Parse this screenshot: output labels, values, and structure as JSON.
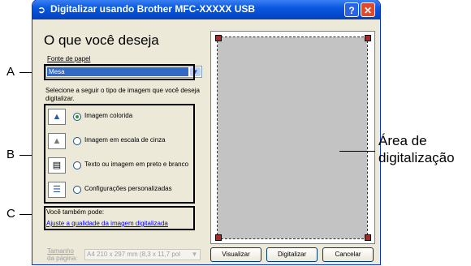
{
  "window": {
    "title": "Digitalizar usando Brother MFC-XXXXX USB",
    "help_label": "?",
    "close_label": "✕"
  },
  "left_panel": {
    "heading": "O que você deseja",
    "paper_source_label": "Fonte de papel",
    "paper_source_value": "Mesa",
    "instruction": "Selecione a seguir o tipo de imagem que você deseja digitalizar.",
    "options": [
      {
        "label": "Imagem colorida",
        "selected": true,
        "icon": "color-image-icon"
      },
      {
        "label": "Imagem em escala de cinza",
        "selected": false,
        "icon": "grayscale-image-icon"
      },
      {
        "label": "Texto ou imagem em preto e branco",
        "selected": false,
        "icon": "black-white-text-icon"
      },
      {
        "label": "Configurações personalizadas",
        "selected": false,
        "icon": "custom-settings-icon"
      }
    ],
    "also_label": "Você também pode:",
    "adjust_link": "Ajuste a qualidade da imagem digitalizada",
    "page_size_label_1": "Tamanho",
    "page_size_label_2": "da página:",
    "page_size_value": "A4 210 x 297 mm (8,3 x 11,7 pol"
  },
  "buttons": {
    "preview": "Visualizar",
    "scan": "Digitalizar",
    "cancel": "Cancelar"
  },
  "callouts": {
    "a": "A",
    "b": "B",
    "c": "C",
    "area_line1": "Área de",
    "area_line2": "digitalização"
  }
}
